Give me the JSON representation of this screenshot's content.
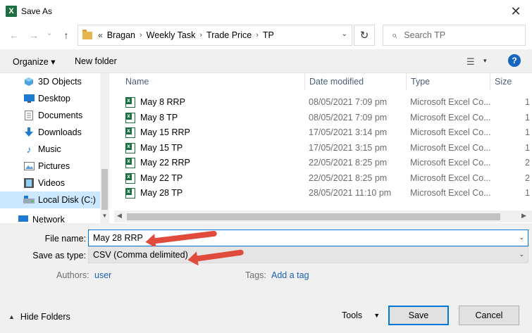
{
  "window": {
    "title": "Save As",
    "app_icon_label": "X",
    "close_glyph": "✕"
  },
  "nav_buttons": {
    "back": "←",
    "forward": "→",
    "recent": "⌄",
    "up": "↑"
  },
  "address": {
    "overflow": "«",
    "crumbs": [
      "Bragan",
      "Weekly Task",
      "Trade Price",
      "TP"
    ],
    "separator": "›",
    "dropdown": "⌄",
    "refresh": "↻"
  },
  "search": {
    "placeholder": "Search TP"
  },
  "toolbar": {
    "organize": "Organize ▾",
    "new_folder": "New folder",
    "view_glyph": "☰",
    "view_dd": "▾",
    "help": "?"
  },
  "sidebar": {
    "items": [
      {
        "label": "3D Objects",
        "icon": "cube-icon"
      },
      {
        "label": "Desktop",
        "icon": "desktop-icon"
      },
      {
        "label": "Documents",
        "icon": "documents-icon"
      },
      {
        "label": "Downloads",
        "icon": "downloads-icon"
      },
      {
        "label": "Music",
        "icon": "music-icon"
      },
      {
        "label": "Pictures",
        "icon": "pictures-icon"
      },
      {
        "label": "Videos",
        "icon": "videos-icon"
      },
      {
        "label": "Local Disk (C:)",
        "icon": "disk-icon",
        "selected": true
      },
      {
        "label": "Network",
        "icon": "network-icon"
      }
    ]
  },
  "columns": {
    "name": "Name",
    "date": "Date modified",
    "type": "Type",
    "size": "Size"
  },
  "files": [
    {
      "name": "May 8 RRP",
      "date": "08/05/2021 7:09 pm",
      "type": "Microsoft Excel Co...",
      "size": "1"
    },
    {
      "name": "May 8 TP",
      "date": "08/05/2021 7:09 pm",
      "type": "Microsoft Excel Co...",
      "size": "1"
    },
    {
      "name": "May 15 RRP",
      "date": "17/05/2021 3:14 pm",
      "type": "Microsoft Excel Co...",
      "size": "1"
    },
    {
      "name": "May 15 TP",
      "date": "17/05/2021 3:15 pm",
      "type": "Microsoft Excel Co...",
      "size": "1"
    },
    {
      "name": "May 22 RRP",
      "date": "22/05/2021 8:25 pm",
      "type": "Microsoft Excel Co...",
      "size": "2"
    },
    {
      "name": "May 22 TP",
      "date": "22/05/2021 8:25 pm",
      "type": "Microsoft Excel Co...",
      "size": "2"
    },
    {
      "name": "May 28 TP",
      "date": "28/05/2021 11:10 pm",
      "type": "Microsoft Excel Co...",
      "size": "1"
    }
  ],
  "form": {
    "file_name_label": "File name:",
    "file_name_value": "May 28 RRP",
    "save_type_label": "Save as type:",
    "save_type_value": "CSV (Comma delimited)",
    "authors_label": "Authors:",
    "authors_value": "user",
    "tags_label": "Tags:",
    "tags_value": "Add a tag"
  },
  "footer": {
    "hide_folders": "Hide Folders",
    "tools": "Tools",
    "save": "Save",
    "cancel": "Cancel"
  },
  "colors": {
    "accent": "#0078d7",
    "annotation_arrow": "#e14b3b",
    "excel_green": "#1d6f42",
    "selected_bg": "#cce8ff"
  }
}
